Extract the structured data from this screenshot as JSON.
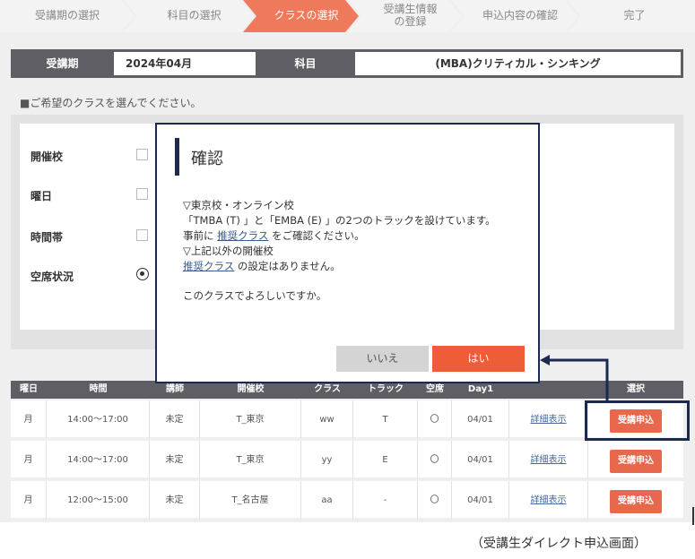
{
  "steps": [
    {
      "label": "受講期の選択"
    },
    {
      "label": "科目の選択"
    },
    {
      "label": "クラスの選択"
    },
    {
      "label_line1": "受講生情報",
      "label_line2": "の登録"
    },
    {
      "label": "申込内容の確認"
    },
    {
      "label": "完了"
    }
  ],
  "colors": {
    "active_step": "#ef7a5b",
    "dark": "#5e5e64",
    "navy": "#1c2a4f",
    "accent": "#ef5d38"
  },
  "info": {
    "period_label": "受講期",
    "period_value": "2024年04月",
    "subject_label": "科目",
    "subject_value": "(MBA)クリティカル・シンキング"
  },
  "instruction": "■ご希望のクラスを選んでください。",
  "filters": {
    "school_label": "開催校",
    "day_label": "曜日",
    "time_label": "時間帯",
    "vacancy_label": "空席状況"
  },
  "table": {
    "headers": [
      "曜日",
      "時間",
      "講師",
      "開催校",
      "クラス",
      "トラック",
      "空席",
      "Day1",
      "選択"
    ],
    "rows": [
      {
        "day": "月",
        "time": "14:00～17:00",
        "teacher": "未定",
        "school": "T_東京",
        "class": "ww",
        "track": "T",
        "vacancy": "〇",
        "day1": "04/01",
        "detail": "詳細表示",
        "apply": "受講申込"
      },
      {
        "day": "月",
        "time": "14:00～17:00",
        "teacher": "未定",
        "school": "T_東京",
        "class": "yy",
        "track": "E",
        "vacancy": "〇",
        "day1": "04/01",
        "detail": "詳細表示",
        "apply": "受講申込"
      },
      {
        "day": "月",
        "time": "12:00～15:00",
        "teacher": "未定",
        "school": "T_名古屋",
        "class": "aa",
        "track": "-",
        "vacancy": "〇",
        "day1": "04/01",
        "detail": "詳細表示",
        "apply": "受講申込"
      }
    ]
  },
  "modal": {
    "title": "確認",
    "line1": "▽東京校・オンライン校",
    "line2": "「TMBA (T) 」と「EMBA (E) 」の2つのトラックを設けています。",
    "line3_pre": "事前に ",
    "line3_link": "推奨クラス",
    "line3_post": " をご確認ください。",
    "line4": "▽上記以外の開催校",
    "line5_link": "推奨クラス",
    "line5_post": " の設定はありません。",
    "line6": "このクラスでよろしいですか。",
    "no_label": "いいえ",
    "yes_label": "はい"
  },
  "caption": "（受講生ダイレクト申込画面）"
}
